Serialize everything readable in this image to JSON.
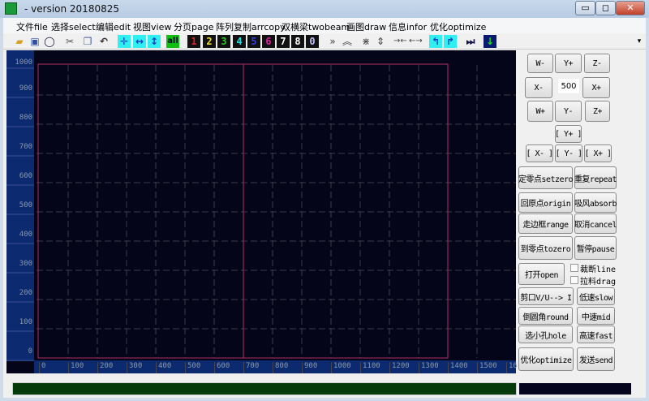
{
  "window": {
    "title": "- version 20180825",
    "minimize": "▭",
    "maximize": "◻",
    "close": "✕"
  },
  "menu": [
    "文件file",
    "选择select",
    "编辑edit",
    "视图view",
    "分页page",
    "阵列复制arrcopy",
    "双横梁twobeam",
    "画图draw",
    "信息infor",
    "优化optimize"
  ],
  "toolbar": {
    "all": "all",
    "nums": [
      "1",
      "2",
      "3",
      "4",
      "5",
      "6",
      "7",
      "8",
      "0"
    ],
    "num_colors": [
      "#e02020",
      "#f0e020",
      "#20d020",
      "#20e0e0",
      "#3040e0",
      "#e020a0",
      "#ffffff",
      "#ffffff",
      "#c0c0ff"
    ],
    "overflow": "▾"
  },
  "plot": {
    "y_ticks": [
      "1000",
      "900",
      "800",
      "700",
      "600",
      "500",
      "400",
      "300",
      "200",
      "100",
      "0"
    ],
    "x_ticks": [
      "0",
      "100",
      "200",
      "300",
      "400",
      "500",
      "600",
      "700",
      "800",
      "900",
      "1000",
      "1100",
      "1200",
      "1300",
      "1400",
      "1500",
      "16"
    ],
    "background": "#05051a",
    "ruler_color": "#0c2a70",
    "frame_color": "#b03060"
  },
  "jog": {
    "w_minus": "W-",
    "y_plus": "Y+",
    "z_minus": "Z-",
    "x_minus": "X-",
    "step": "500",
    "x_plus": "X+",
    "w_plus": "W+",
    "y_minus": "Y-",
    "z_plus": "Z+",
    "by_plus": "[ Y+ ]",
    "bx_minus": "[ X- ]",
    "by_minus": "[ Y- ]",
    "bx_plus": "[ X+ ]"
  },
  "actions": {
    "setzero": "定零点setzero",
    "repeat": "重复repeat",
    "origin": "回原点origin",
    "absorb": "吸风absorb",
    "range": "走边框range",
    "cancel": "取消cancel",
    "tozero": "到零点tozero",
    "pause": "暂停pause",
    "open": "打开open",
    "line": "裁断line",
    "drag": "拉料drag",
    "cut": "剪口V/U--> I",
    "slow": "低速slow",
    "round": "倒圆角round",
    "mid": "中速mid",
    "hole": "选小孔hole",
    "fast": "高速fast",
    "optimize": "优化optimize",
    "send": "发送send"
  },
  "checks": {
    "line": false,
    "drag": false
  }
}
